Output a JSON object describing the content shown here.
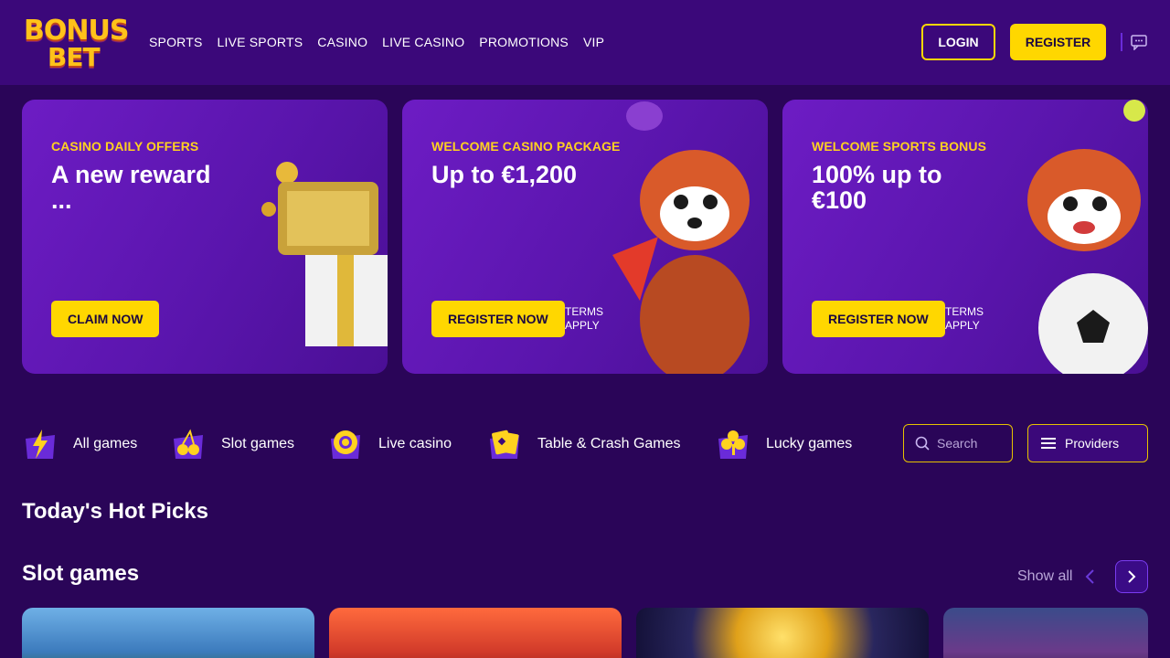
{
  "brand": {
    "logo_line1": "BONUS",
    "logo_line2": "BET"
  },
  "nav": [
    "SPORTS",
    "LIVE SPORTS",
    "CASINO",
    "LIVE CASINO",
    "PROMOTIONS",
    "VIP"
  ],
  "header": {
    "login_label": "LOGIN",
    "register_label": "REGISTER",
    "chat_icon": "chat-icon"
  },
  "promos": [
    {
      "kicker": "CASINO DAILY OFFERS",
      "headline": "A new reward ...",
      "cta": "CLAIM NOW",
      "terms": ""
    },
    {
      "kicker": "WELCOME CASINO PACKAGE",
      "headline": "Up to €1,200",
      "cta": "REGISTER NOW",
      "terms": "TERMS APPLY"
    },
    {
      "kicker": "WELCOME SPORTS BONUS",
      "headline": "100% up to €100",
      "cta": "REGISTER NOW",
      "terms": "TERMS APPLY"
    }
  ],
  "categories": [
    {
      "label": "All games",
      "icon": "lightning-icon"
    },
    {
      "label": "Slot games",
      "icon": "cherries-icon"
    },
    {
      "label": "Live casino",
      "icon": "chip-icon"
    },
    {
      "label": "Table & Crash Games",
      "icon": "cards-icon"
    },
    {
      "label": "Lucky games",
      "icon": "clover-icon"
    }
  ],
  "search": {
    "placeholder": "Search"
  },
  "providers_label": "Providers",
  "sections": {
    "hot_picks": "Today's Hot Picks",
    "slot_games": "Slot games",
    "show_all": "Show all"
  },
  "colors": {
    "accent": "#ffd700",
    "background": "#2a0558",
    "header": "#3b087a",
    "card": "#6d1cc4"
  }
}
